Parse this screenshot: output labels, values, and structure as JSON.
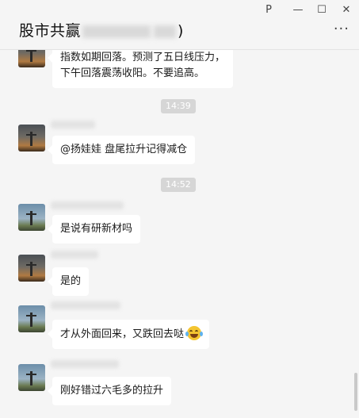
{
  "window": {
    "title_prefix": "股市共赢",
    "title_suffix": ")",
    "controls": {
      "pin": "P",
      "minimize": "—",
      "maximize": "☐",
      "close": "✕"
    },
    "more_label": "···"
  },
  "messages": [
    {
      "type": "text",
      "avatar": "sunset-avatar",
      "lines": [
        "指数如期回落。预测了五日线压力，",
        "下午回落震荡收阳。不要追高。"
      ]
    },
    {
      "type": "time",
      "text": "14:39"
    },
    {
      "type": "text",
      "avatar": "sunset-avatar",
      "lines": [
        "@扬娃娃  盘尾拉升记得减仓"
      ]
    },
    {
      "type": "time",
      "text": "14:52"
    },
    {
      "type": "text",
      "avatar": "sky-avatar",
      "lines": [
        "是说有研新材吗"
      ]
    },
    {
      "type": "text",
      "avatar": "sunset-avatar",
      "lines": [
        "是的"
      ]
    },
    {
      "type": "text",
      "avatar": "sky-avatar",
      "lines": [
        "才从外面回来，又跌回去哒"
      ],
      "emoji": "laugh-cry-emoji"
    },
    {
      "type": "text",
      "avatar": "sky-avatar",
      "lines": [
        "刚好错过六毛多的拉升"
      ]
    }
  ]
}
